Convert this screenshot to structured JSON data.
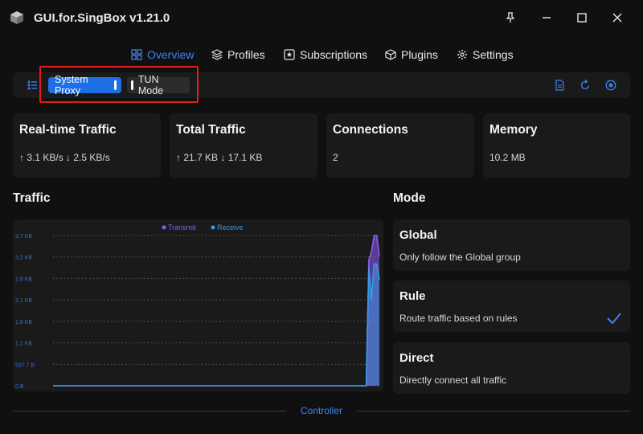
{
  "app": {
    "title": "GUI.for.SingBox v1.21.0"
  },
  "nav": {
    "items": [
      {
        "label": "Overview",
        "icon": "home-icon",
        "active": true
      },
      {
        "label": "Profiles",
        "icon": "layers-icon",
        "active": false
      },
      {
        "label": "Subscriptions",
        "icon": "subscriptions-icon",
        "active": false
      },
      {
        "label": "Plugins",
        "icon": "plugin-box-icon",
        "active": false
      },
      {
        "label": "Settings",
        "icon": "gear-icon",
        "active": false
      }
    ]
  },
  "toolbar": {
    "system_proxy_label": "System Proxy",
    "system_proxy_on": true,
    "tun_mode_label": "TUN Mode",
    "tun_mode_on": false
  },
  "stats": {
    "realtime": {
      "title": "Real-time Traffic",
      "value": "↑ 3.1 KB/s ↓ 2.5 KB/s"
    },
    "total": {
      "title": "Total Traffic",
      "value": "↑ 21.7 KB ↓ 17.1 KB"
    },
    "connections": {
      "title": "Connections",
      "value": "2"
    },
    "memory": {
      "title": "Memory",
      "value": "10.2 MB"
    }
  },
  "traffic_section": {
    "title": "Traffic"
  },
  "mode_section": {
    "title": "Mode"
  },
  "modes": [
    {
      "title": "Global",
      "description": "Only follow the Global group",
      "selected": false
    },
    {
      "title": "Rule",
      "description": "Route traffic based on rules",
      "selected": true
    },
    {
      "title": "Direct",
      "description": "Directly connect all traffic",
      "selected": false
    }
  ],
  "controller": {
    "label": "Controller"
  },
  "colors": {
    "accent": "#3b82f6",
    "transmit": "#8b5cf6",
    "receive": "#3b9ae6",
    "highlight": "#e11d1d"
  },
  "chart_data": {
    "type": "area",
    "legend_position": "top-center",
    "grid": true,
    "y_ticks": [
      "3.7 KB",
      "3.2 KB",
      "2.6 KB",
      "2.1 KB",
      "1.6 KB",
      "1.1 KB",
      "537.7 B",
      "0 B"
    ],
    "ylim": [
      0,
      3.7
    ],
    "series": [
      {
        "name": "Transmit",
        "values": [
          0,
          0,
          0,
          0,
          0,
          0,
          0,
          0,
          0,
          0,
          0,
          0,
          0,
          0,
          0,
          0,
          0,
          0,
          0,
          0,
          0,
          0,
          0,
          0,
          0,
          0,
          0,
          0,
          0,
          0,
          0,
          0,
          0,
          0,
          0,
          0,
          0,
          0,
          0,
          0,
          0,
          0,
          0,
          0,
          0,
          0,
          0,
          0,
          0,
          0,
          0,
          0,
          0,
          0,
          0,
          0,
          0,
          0,
          0,
          0,
          0,
          0,
          0,
          0,
          0,
          0,
          0,
          0,
          0,
          0,
          0,
          0,
          0,
          0,
          0,
          0,
          0,
          0,
          0,
          0,
          0,
          0,
          0,
          0,
          0,
          0,
          0,
          0,
          0,
          0,
          0,
          0,
          0,
          0,
          0,
          0,
          0,
          0,
          0,
          0,
          0,
          0,
          0,
          0,
          0,
          0,
          0,
          0,
          0,
          0,
          0,
          0,
          0,
          0,
          0,
          0,
          0,
          0,
          0,
          0,
          3.1,
          3.3,
          3.7,
          3.7,
          3.2
        ]
      },
      {
        "name": "Receive",
        "values": [
          0,
          0,
          0,
          0,
          0,
          0,
          0,
          0,
          0,
          0,
          0,
          0,
          0,
          0,
          0,
          0,
          0,
          0,
          0,
          0,
          0,
          0,
          0,
          0,
          0,
          0,
          0,
          0,
          0,
          0,
          0,
          0,
          0,
          0,
          0,
          0,
          0,
          0,
          0,
          0,
          0,
          0,
          0,
          0,
          0,
          0,
          0,
          0,
          0,
          0,
          0,
          0,
          0,
          0,
          0,
          0,
          0,
          0,
          0,
          0,
          0,
          0,
          0,
          0,
          0,
          0,
          0,
          0,
          0,
          0,
          0,
          0,
          0,
          0,
          0,
          0,
          0,
          0,
          0,
          0,
          0,
          0,
          0,
          0,
          0,
          0,
          0,
          0,
          0,
          0,
          0,
          0,
          0,
          0,
          0,
          0,
          0,
          0,
          0,
          0,
          0,
          0,
          0,
          0,
          0,
          0,
          0,
          0,
          0,
          0,
          0,
          0,
          0,
          0,
          0,
          0,
          0,
          0,
          0,
          0,
          2.9,
          2.1,
          3.0,
          3.0,
          2.6
        ]
      }
    ]
  }
}
